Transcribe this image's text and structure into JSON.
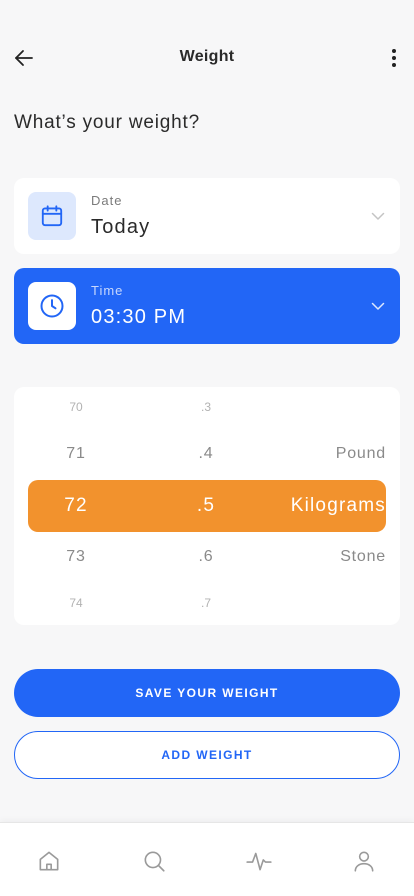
{
  "header": {
    "title": "Weight",
    "back_icon": "arrow-left-icon",
    "menu_icon": "more-vertical-icon"
  },
  "question": "What’s your weight?",
  "date_card": {
    "label": "Date",
    "value": "Today",
    "icon": "calendar-icon"
  },
  "time_card": {
    "label": "Time",
    "value": "03:30 PM",
    "icon": "clock-icon"
  },
  "picker": {
    "rows": [
      {
        "whole": "70",
        "decimal": ".3",
        "unit": ""
      },
      {
        "whole": "71",
        "decimal": ".4",
        "unit": "Pound"
      },
      {
        "whole": "72",
        "decimal": ".5",
        "unit": "Kilograms"
      },
      {
        "whole": "73",
        "decimal": ".6",
        "unit": "Stone"
      },
      {
        "whole": "74",
        "decimal": ".7",
        "unit": ""
      }
    ],
    "selected_index": 2
  },
  "buttons": {
    "save": "SAVE YOUR WEIGHT",
    "add": "ADD WEIGHT"
  },
  "bottom_nav": {
    "items": [
      "home-icon",
      "search-icon",
      "activity-icon",
      "profile-icon"
    ]
  },
  "colors": {
    "primary": "#2266f6",
    "accent": "#f2922d",
    "background": "#f7f7f8"
  }
}
